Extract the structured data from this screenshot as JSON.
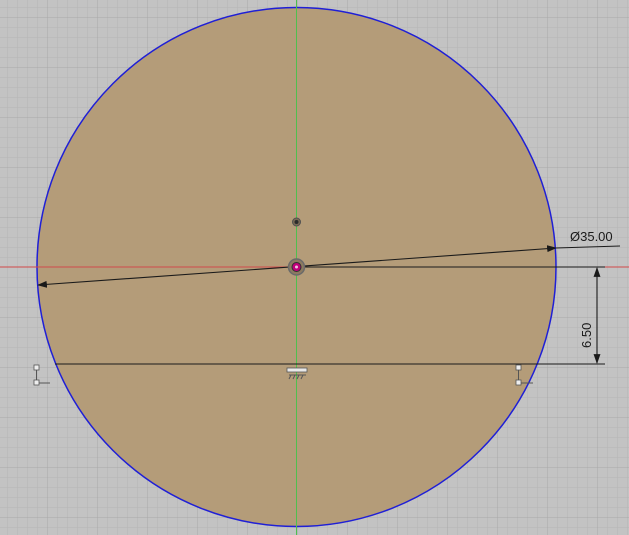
{
  "sketch": {
    "diameter_dimension": "Ø35.00",
    "vertical_dimension": "6.50"
  },
  "colors": {
    "background": "#c3c3c3",
    "grid_minor": "#b7b7b7",
    "grid_major": "#a9a9a9",
    "circle_fill": "#b39a75",
    "circle_edge": "#1f1fd6",
    "x_axis": "#d04a4a",
    "y_axis": "#4fbf4f",
    "dimension_line": "#1a1a1a",
    "center_point": "#c0007a"
  },
  "icons": {
    "horizontal_constraint": "horizontal-constraint-icon",
    "coincident_constraint": "coincident-constraint-icon",
    "fix_constraint": "fix-constraint-icon"
  }
}
